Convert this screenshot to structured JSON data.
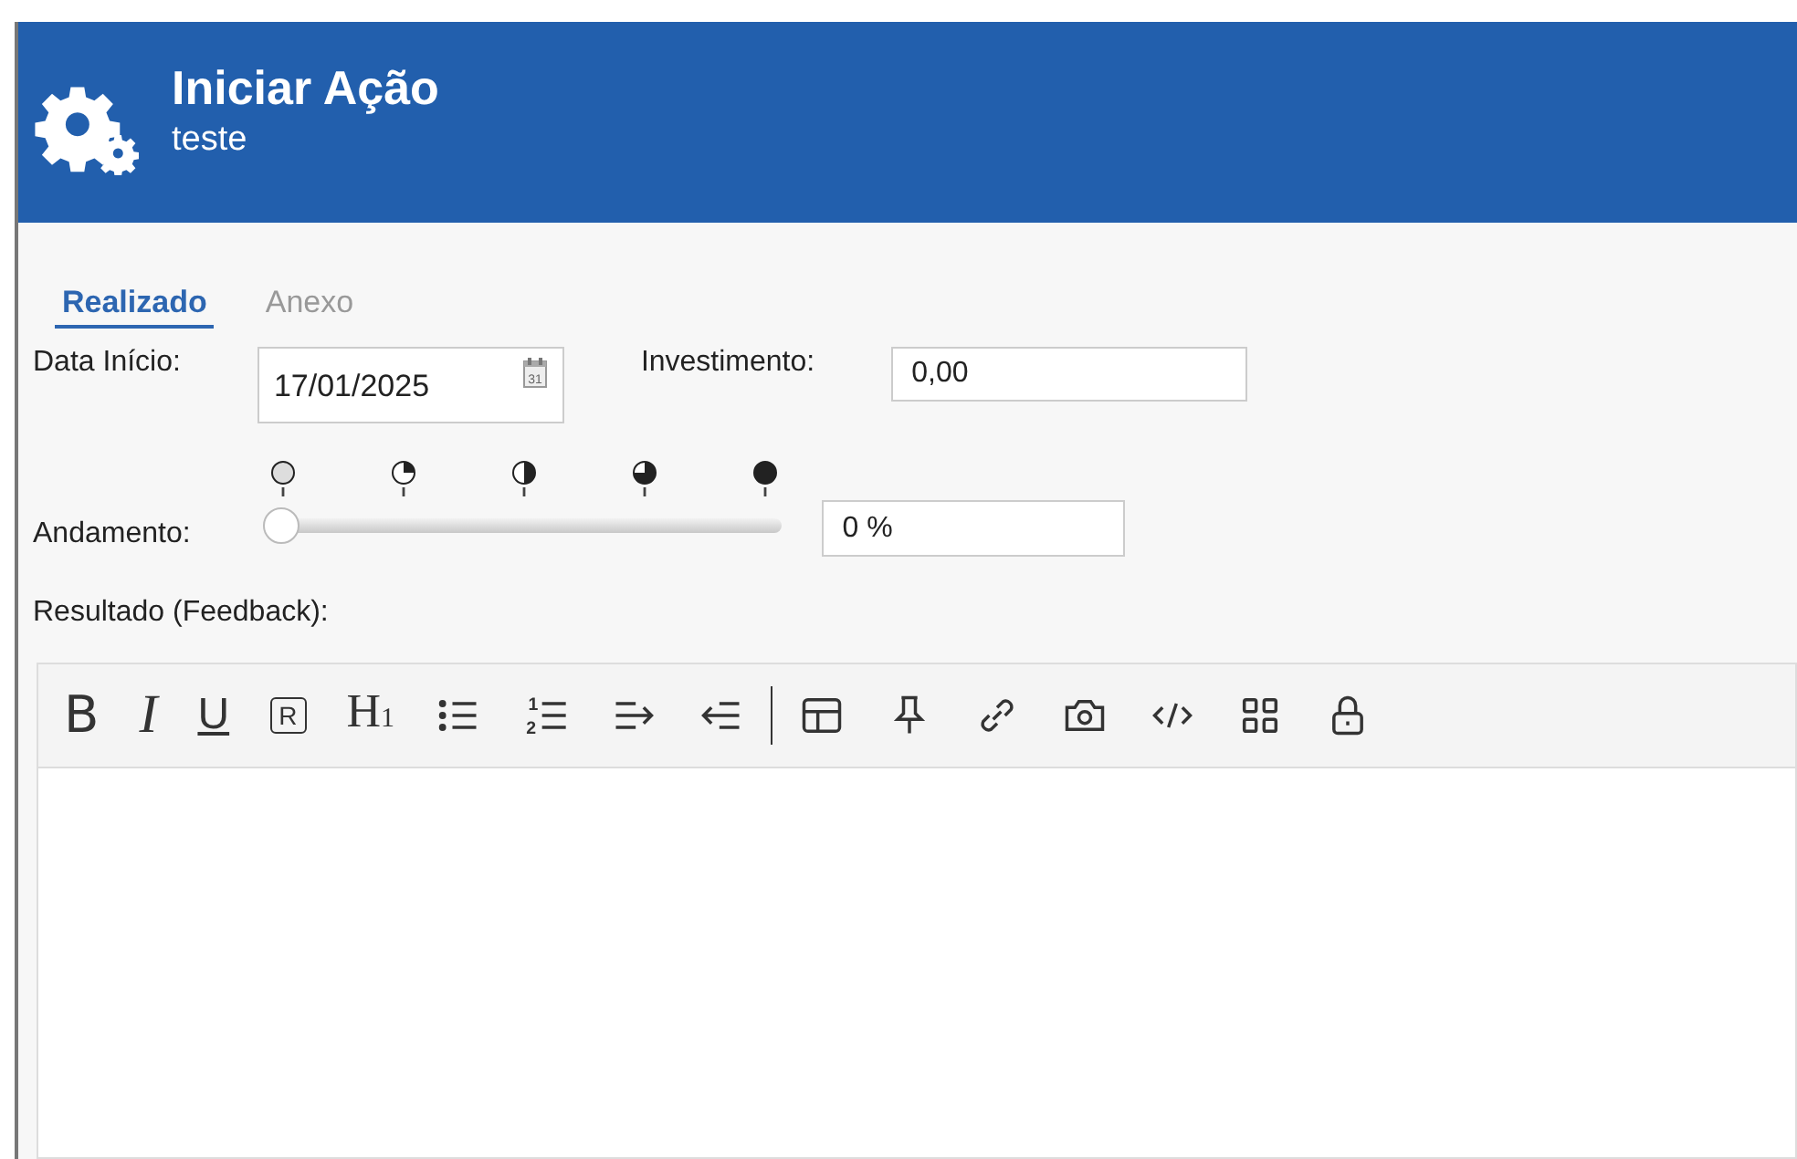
{
  "header": {
    "title": "Iniciar Ação",
    "subtitle": "teste"
  },
  "tabs": [
    {
      "label": "Realizado",
      "selected": true
    },
    {
      "label": "Anexo",
      "selected": false
    }
  ],
  "form": {
    "date_label": "Data Início:",
    "date_value": "17/01/2025",
    "calendar_day": "31",
    "investment_label": "Investimento:",
    "investment_value": "0,00",
    "progress_label": "Andamento:",
    "progress": {
      "level": 0
    },
    "progress_value": "0 %",
    "result_label": "Resultado (Feedback):"
  },
  "toolbar": [
    {
      "kind": "bold",
      "label": "B"
    },
    {
      "kind": "italic",
      "label": "I"
    },
    {
      "kind": "underline",
      "label": "U"
    },
    {
      "kind": "boxed",
      "label": "R"
    },
    {
      "kind": "heading",
      "label": "H",
      "sub": "1"
    },
    {
      "kind": "bullets"
    },
    {
      "kind": "numbers",
      "digits": [
        "1",
        "2"
      ]
    },
    {
      "kind": "indent"
    },
    {
      "kind": "outdent"
    },
    {
      "kind": "table"
    },
    {
      "kind": "pin"
    },
    {
      "kind": "link"
    },
    {
      "kind": "camera"
    },
    {
      "kind": "code"
    },
    {
      "kind": "grid"
    },
    {
      "kind": "lock"
    }
  ]
}
